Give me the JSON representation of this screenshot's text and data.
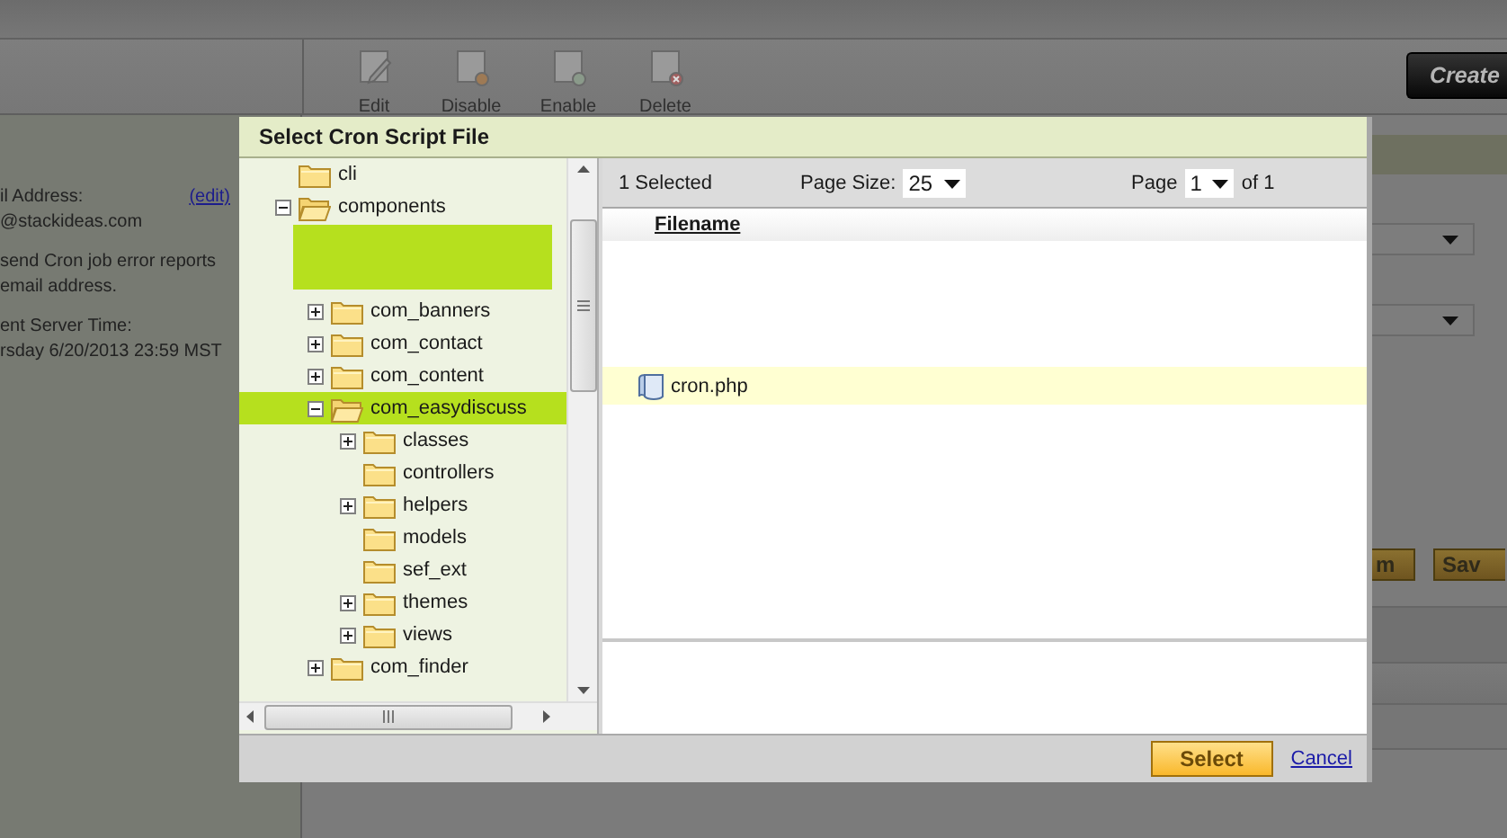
{
  "background": {
    "toolbar": [
      {
        "kind": "edit",
        "label": "Edit"
      },
      {
        "kind": "disable",
        "label": "Disable"
      },
      {
        "kind": "enable",
        "label": "Enable"
      },
      {
        "kind": "delete",
        "label": "Delete"
      }
    ],
    "create_button": "Create",
    "details": {
      "email_label": "il Address:",
      "edit_link": "(edit)",
      "email": "@stackideas.com",
      "note_lines": [
        "send Cron job error reports",
        "email address."
      ],
      "time_label": "ent Server Time:",
      "time_value": "rsday 6/20/2013 23:59 MST"
    },
    "side_buttons": [
      "m",
      "Sav"
    ]
  },
  "dialog": {
    "title": "Select Cron Script File",
    "tree": [
      {
        "kind": "folder",
        "label": "cli",
        "expandable": false,
        "expanded": false,
        "selected": false
      },
      {
        "kind": "folder",
        "label": "components",
        "expandable": true,
        "expanded": true,
        "selected": false,
        "children": [
          {
            "kind": "blank"
          },
          {
            "kind": "folder",
            "label": "com_banners",
            "expandable": true,
            "expanded": false,
            "selected": false
          },
          {
            "kind": "folder",
            "label": "com_contact",
            "expandable": true,
            "expanded": false,
            "selected": false
          },
          {
            "kind": "folder",
            "label": "com_content",
            "expandable": true,
            "expanded": false,
            "selected": false
          },
          {
            "kind": "folder",
            "label": "com_easydiscuss",
            "expandable": true,
            "expanded": true,
            "selected": true,
            "children": [
              {
                "kind": "folder",
                "label": "classes",
                "expandable": true,
                "expanded": false,
                "selected": false
              },
              {
                "kind": "folder",
                "label": "controllers",
                "expandable": false,
                "expanded": false,
                "selected": false
              },
              {
                "kind": "folder",
                "label": "helpers",
                "expandable": true,
                "expanded": false,
                "selected": false
              },
              {
                "kind": "folder",
                "label": "models",
                "expandable": false,
                "expanded": false,
                "selected": false
              },
              {
                "kind": "folder",
                "label": "sef_ext",
                "expandable": false,
                "expanded": false,
                "selected": false
              },
              {
                "kind": "folder",
                "label": "themes",
                "expandable": true,
                "expanded": false,
                "selected": false
              },
              {
                "kind": "folder",
                "label": "views",
                "expandable": true,
                "expanded": false,
                "selected": false
              }
            ]
          },
          {
            "kind": "folder",
            "label": "com_finder",
            "expandable": true,
            "expanded": false,
            "selected": false
          }
        ]
      }
    ],
    "pager": {
      "selected_count": "1 Selected",
      "page_size_label": "Page Size:",
      "page_size": "25",
      "page_label": "Page",
      "page": "1",
      "page_total": "of 1"
    },
    "grid": {
      "columns": [
        "Filename"
      ],
      "rows": [
        {
          "name": "cron.php",
          "selected": true
        }
      ]
    },
    "buttons": {
      "select": "Select",
      "cancel": "Cancel"
    }
  }
}
